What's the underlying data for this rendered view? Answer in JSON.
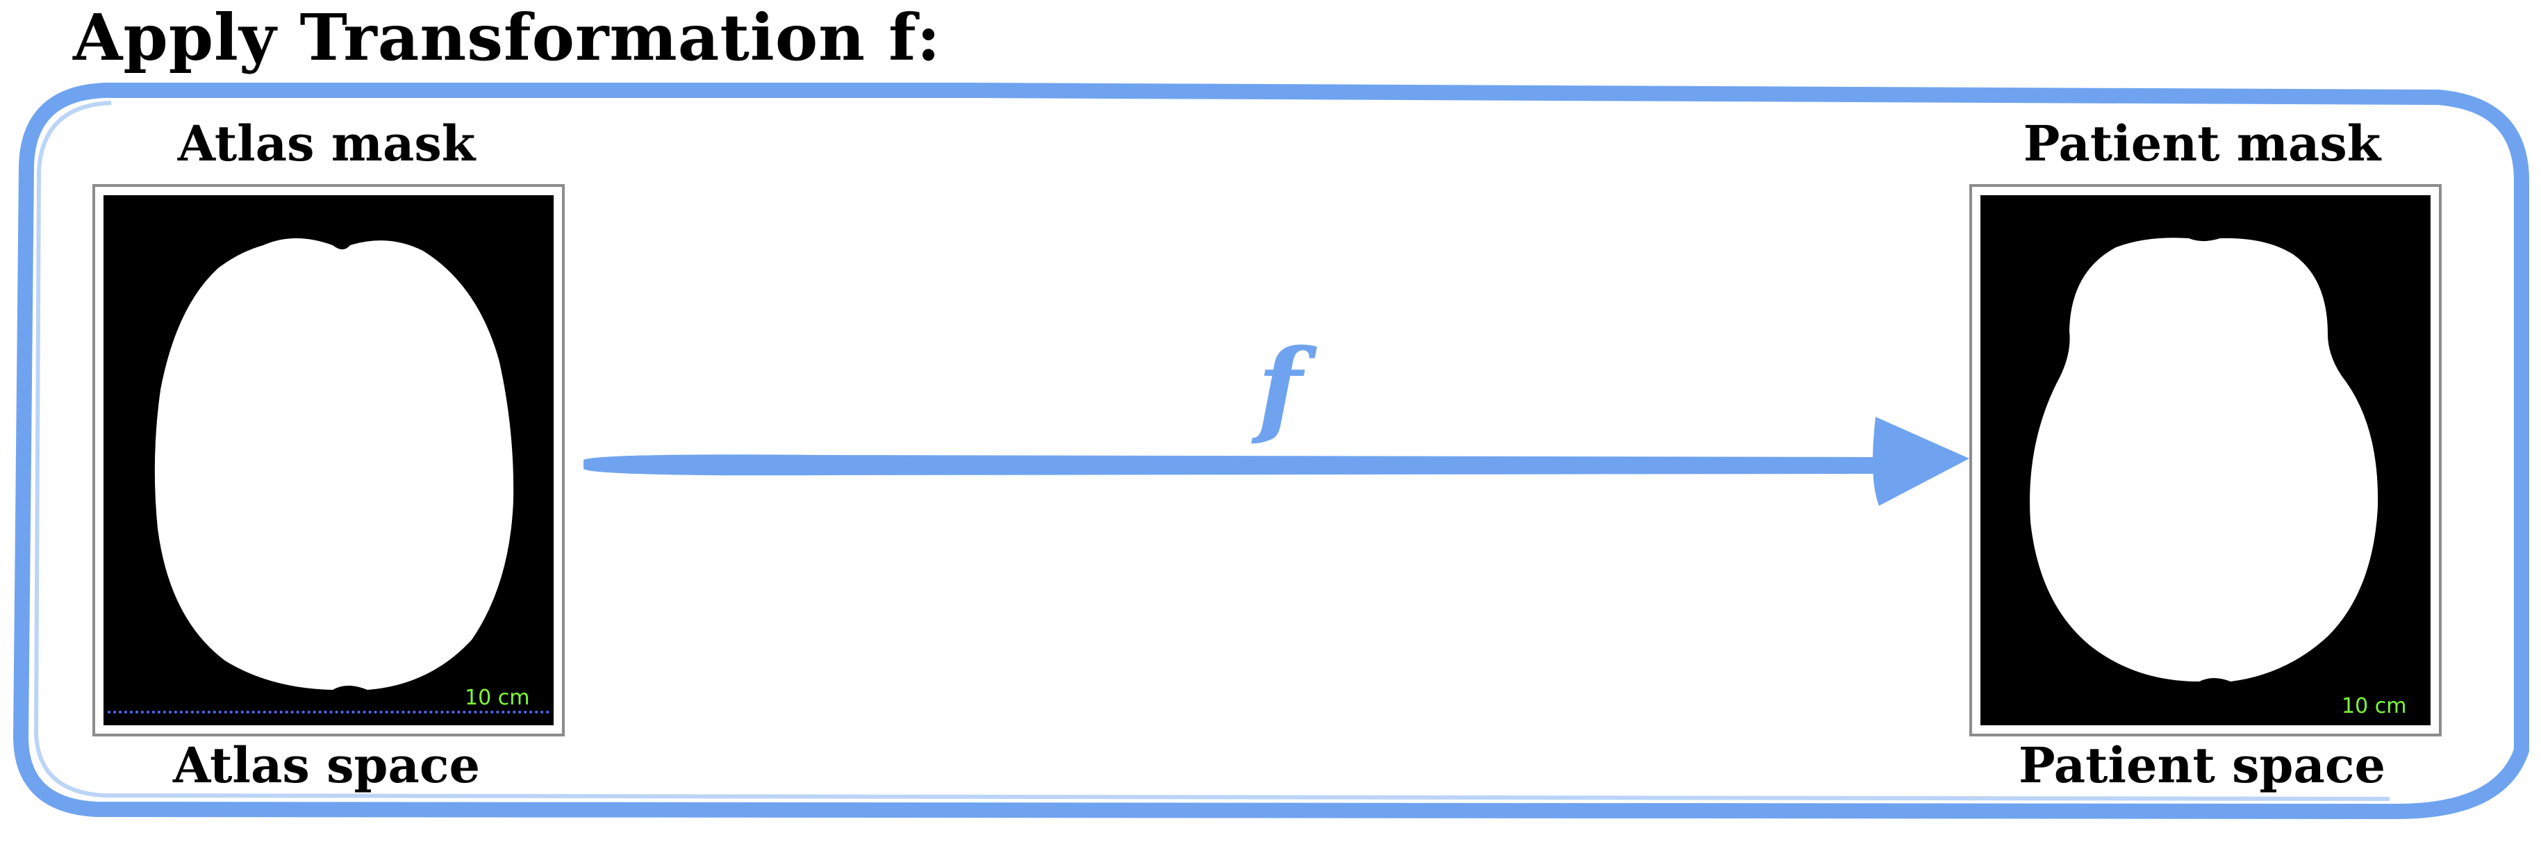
{
  "title": "Apply Transformation f:",
  "left_panel": {
    "label_top": "Atlas mask",
    "label_bottom": "Atlas space",
    "scale_text": "10 cm"
  },
  "right_panel": {
    "label_top": "Patient mask",
    "label_bottom": "Patient space",
    "scale_text": "10 cm"
  },
  "arrow": {
    "label": "f"
  },
  "colors": {
    "accent_blue": "#6fa3ef",
    "scale_green": "#7CFC3A",
    "scale_line_blue": "#4f6bff"
  }
}
